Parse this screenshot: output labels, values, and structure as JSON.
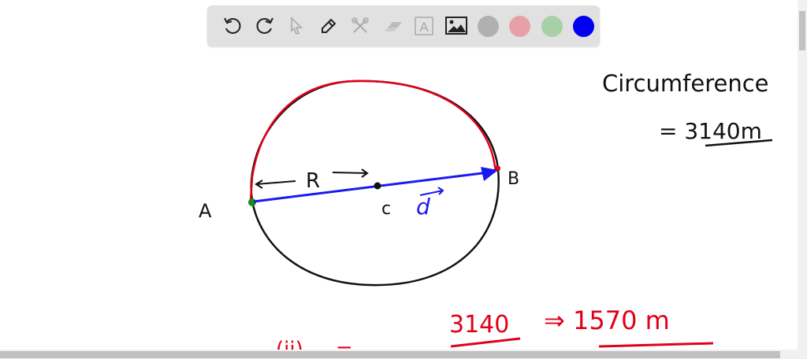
{
  "toolbar": {
    "tools": [
      {
        "name": "undo-icon"
      },
      {
        "name": "redo-icon"
      },
      {
        "name": "select-icon"
      },
      {
        "name": "pen-icon"
      },
      {
        "name": "tools-icon"
      },
      {
        "name": "eraser-icon"
      },
      {
        "name": "text-icon",
        "label": "A"
      },
      {
        "name": "image-icon"
      }
    ],
    "colors": [
      "#b0b0b0",
      "#e8a0a8",
      "#a8d0a8",
      "#0000ee"
    ],
    "selected_color": "#0000ee"
  },
  "drawing": {
    "circumference_label": "Circumference",
    "circumference_value": "= 3140m",
    "point_a": "A",
    "point_b": "B",
    "center": "c",
    "radius": "R",
    "diameter": "d",
    "equation_left": "(ii) ... =",
    "numerator": "3140",
    "result": "⇒ 1570 m",
    "colors": {
      "ink": "#111111",
      "red": "#e0001a",
      "blue": "#1a1aee",
      "green": "#1a8a1a"
    }
  }
}
